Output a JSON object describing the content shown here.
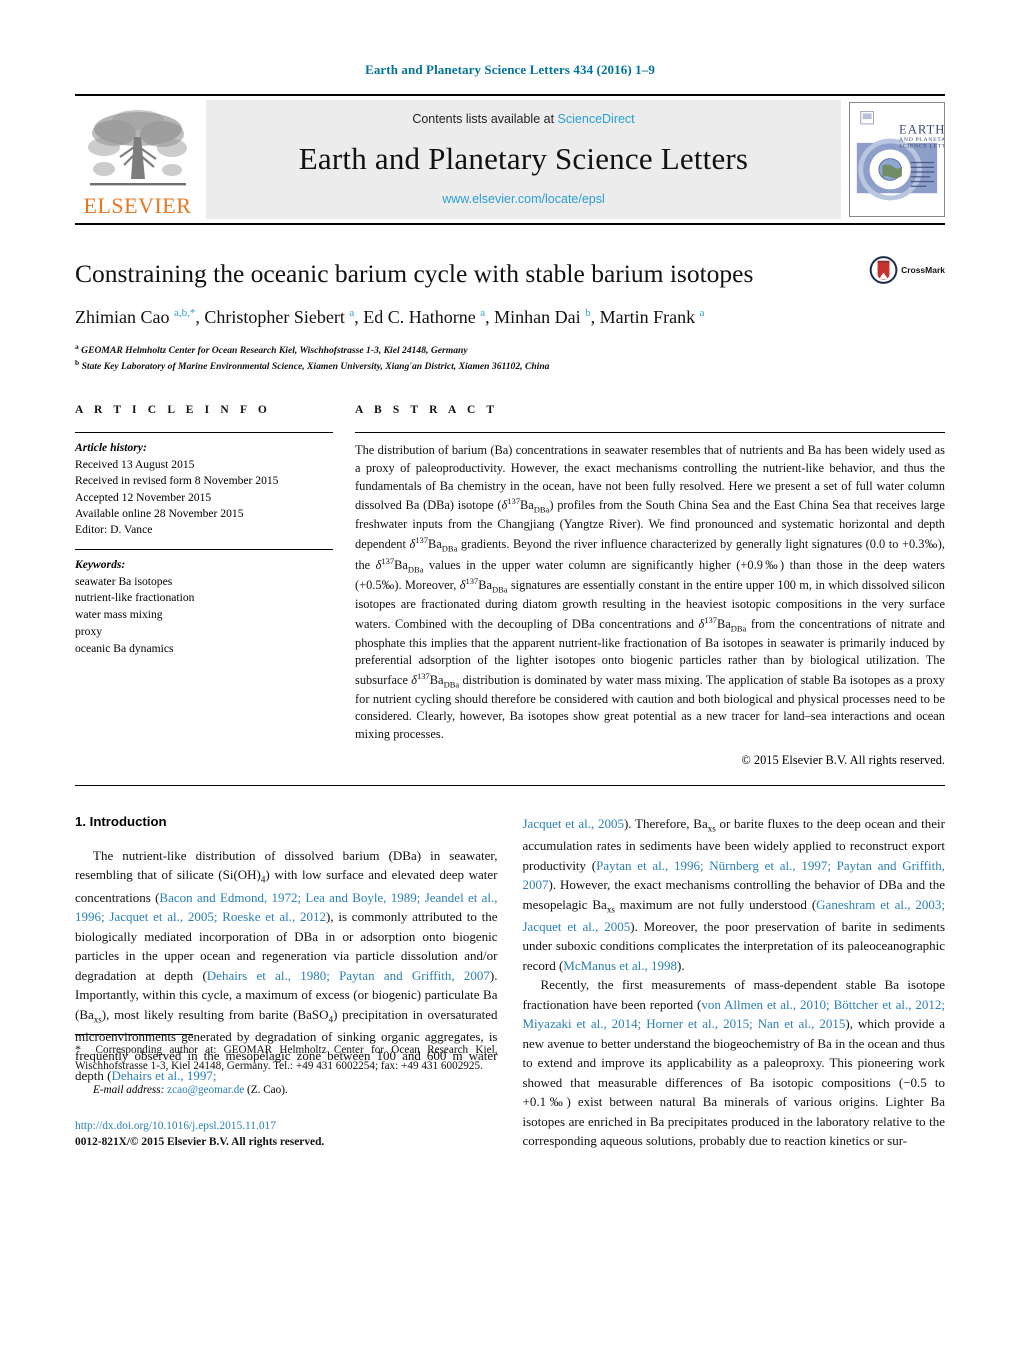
{
  "running_head": "Earth and Planetary Science Letters 434 (2016) 1–9",
  "masthead": {
    "contents_prefix": "Contents lists available at",
    "contents_link": "ScienceDirect",
    "journal_title": "Earth and Planetary Science Letters",
    "journal_url": "www.elsevier.com/locate/epsl",
    "publisher_name": "ELSEVIER",
    "cover_title_lines": [
      "EARTH",
      "AND PLANETARY",
      "SCIENCE LETTERS"
    ]
  },
  "article": {
    "title": "Constraining the oceanic barium cycle with stable barium isotopes",
    "crossmark_label": "CrossMark",
    "authors_html": "Zhimian Cao <sup>a,b,*</sup>, Christopher Siebert <sup>a</sup>, Ed C. Hathorne <sup>a</sup>, Minhan Dai <sup>b</sup>, Martin Frank <sup>a</sup>",
    "affiliations": [
      {
        "marker": "a",
        "text": "GEOMAR Helmholtz Center for Ocean Research Kiel, Wischhofstrasse 1-3, Kiel 24148, Germany"
      },
      {
        "marker": "b",
        "text": "State Key Laboratory of Marine Environmental Science, Xiamen University, Xiang'an District, Xiamen 361102, China"
      }
    ]
  },
  "article_info": {
    "heading": "A R T I C L E   I N F O",
    "history_label": "Article history:",
    "history": [
      "Received 13 August 2015",
      "Received in revised form 8 November 2015",
      "Accepted 12 November 2015",
      "Available online 28 November 2015",
      "Editor: D. Vance"
    ],
    "keywords_label": "Keywords:",
    "keywords": [
      "seawater Ba isotopes",
      "nutrient-like fractionation",
      "water mass mixing",
      "proxy",
      "oceanic Ba dynamics"
    ]
  },
  "abstract": {
    "heading": "A B S T R A C T",
    "html": "The distribution of barium (Ba) concentrations in seawater resembles that of nutrients and Ba has been widely used as a proxy of paleoproductivity. However, the exact mechanisms controlling the nutrient-like behavior, and thus the fundamentals of Ba chemistry in the ocean, have not been fully resolved. Here we present a set of full water column dissolved Ba (DBa) isotope (<i>δ</i><sup>137</sup>Ba<sub>DBa</sub>) profiles from the South China Sea and the East China Sea that receives large freshwater inputs from the Changjiang (Yangtze River). We find pronounced and systematic horizontal and depth dependent <i>δ</i><sup>137</sup>Ba<sub>DBa</sub> gradients. Beyond the river influence characterized by generally light signatures (0.0 to +0.3‰), the <i>δ</i><sup>137</sup>Ba<sub>DBa</sub> values in the upper water column are significantly higher (+0.9‰) than those in the deep waters (+0.5‰). Moreover, <i>δ</i><sup>137</sup>Ba<sub>DBa</sub> signatures are essentially constant in the entire upper 100 m, in which dissolved silicon isotopes are fractionated during diatom growth resulting in the heaviest isotopic compositions in the very surface waters. Combined with the decoupling of DBa concentrations and <i>δ</i><sup>137</sup>Ba<sub>DBa</sub> from the concentrations of nitrate and phosphate this implies that the apparent nutrient-like fractionation of Ba isotopes in seawater is primarily induced by preferential adsorption of the lighter isotopes onto biogenic particles rather than by biological utilization. The subsurface <i>δ</i><sup>137</sup>Ba<sub>DBa</sub> distribution is dominated by water mass mixing. The application of stable Ba isotopes as a proxy for nutrient cycling should therefore be considered with caution and both biological and physical processes need to be considered. Clearly, however, Ba isotopes show great potential as a new tracer for land–sea interactions and ocean mixing processes.",
    "copyright": "© 2015 Elsevier B.V. All rights reserved."
  },
  "body": {
    "section_heading": "1. Introduction",
    "left_paragraph_html": "The nutrient-like distribution of dissolved barium (DBa) in seawater, resembling that of silicate (Si(OH)<sub>4</sub>) with low surface and elevated deep water concentrations (<span class=\"cite\">Bacon and Edmond, 1972; Lea and Boyle, 1989; Jeandel et al., 1996; Jacquet et al., 2005; Roeske et al., 2012</span>), is commonly attributed to the biologically mediated incorporation of DBa in or adsorption onto biogenic particles in the upper ocean and regeneration via particle dissolution and/or degradation at depth (<span class=\"cite\">Dehairs et al., 1980; Paytan and Griffith, 2007</span>). Importantly, within this cycle, a maximum of excess (or biogenic) particulate Ba (Ba<sub>xs</sub>), most likely resulting from barite (BaSO<sub>4</sub>) precipitation in oversaturated microenvironments generated by degradation of sinking organic aggregates, is frequently observed in the mesopelagic zone between 100 and 600 m water depth (<span class=\"cite\">Dehairs et al., 1997;</span>",
    "right_paragraph_1_html": "<span class=\"cite\">Jacquet et al., 2005</span>). Therefore, Ba<sub>xs</sub> or barite fluxes to the deep ocean and their accumulation rates in sediments have been widely applied to reconstruct export productivity (<span class=\"cite\">Paytan et al., 1996; Nürnberg et al., 1997; Paytan and Griffith, 2007</span>). However, the exact mechanisms controlling the behavior of DBa and the mesopelagic Ba<sub>xs</sub> maximum are not fully understood (<span class=\"cite\">Ganeshram et al., 2003; Jacquet et al., 2005</span>). Moreover, the poor preservation of barite in sediments under suboxic conditions complicates the interpretation of its paleoceanographic record (<span class=\"cite\">McManus et al., 1998</span>).",
    "right_paragraph_2_html": "Recently, the first measurements of mass-dependent stable Ba isotope fractionation have been reported (<span class=\"cite\">von Allmen et al., 2010; Böttcher et al., 2012; Miyazaki et al., 2014; Horner et al., 2015; Nan et al., 2015</span>), which provide a new avenue to better understand the biogeochemistry of Ba in the ocean and thus to extend and improve its applicability as a paleoproxy. This pioneering work showed that measurable differences of Ba isotopic compositions (−0.5 to +0.1‰) exist between natural Ba minerals of various origins. Lighter Ba isotopes are enriched in Ba precipitates produced in the laboratory relative to the corresponding aqueous solutions, probably due to reaction kinetics or sur-"
  },
  "footnotes": {
    "corresponding_html": "<span class=\"star\">*</span>&nbsp; Corresponding author at: GEOMAR Helmholtz Center for Ocean Research Kiel, Wischhofstrasse 1-3, Kiel 24148, Germany. Tel.: +49 431 6002254; fax: +49 431 6002925.",
    "email_label": "E-mail address:",
    "email": "zcao@geomar.de",
    "email_suffix": "(Z. Cao).",
    "doi": "http://dx.doi.org/10.1016/j.epsl.2015.11.017",
    "issn": "0012-821X/© 2015 Elsevier B.V. All rights reserved."
  },
  "colors": {
    "link_blue": "#2a7fb5",
    "running_head_blue": "#00749c",
    "elsevier_orange": "#e87722",
    "crossmark_red": "#c8322d"
  }
}
